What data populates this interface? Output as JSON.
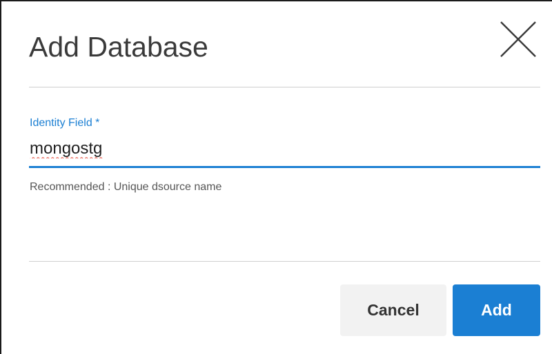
{
  "dialog": {
    "title": "Add Database",
    "close_icon": "close-icon"
  },
  "form": {
    "identity_field": {
      "label": "Identity Field *",
      "value": "mongostg",
      "helper": "Recommended : Unique dsource name"
    }
  },
  "actions": {
    "cancel_label": "Cancel",
    "add_label": "Add"
  },
  "colors": {
    "accent": "#1b7fd3",
    "title_text": "#3a3a3a",
    "cancel_bg": "#f2f2f2",
    "divider": "#cfcfcf",
    "spellcheck": "#e5402f"
  }
}
